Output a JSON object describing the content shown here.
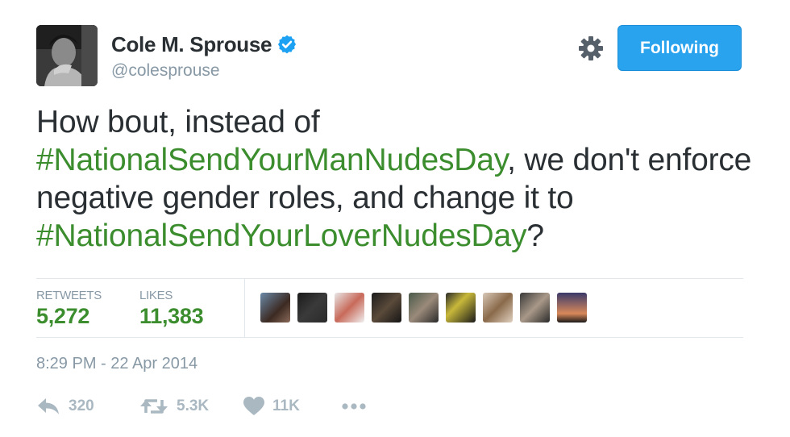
{
  "user": {
    "display_name": "Cole M. Sprouse",
    "handle": "@colesprouse",
    "verified": true
  },
  "follow_button": {
    "label": "Following"
  },
  "tweet": {
    "text_part_1": "How bout, instead of ",
    "hashtag_1": "#NationalSendYourManNudesDay",
    "text_part_2": ", we don't enforce negative gender roles, and change it to ",
    "hashtag_2": "#NationalSendYourLoverNudesDay",
    "text_part_3": "?"
  },
  "stats": {
    "retweets_label": "RETWEETS",
    "retweets_value": "5,272",
    "likes_label": "LIKES",
    "likes_value": "11,383"
  },
  "timestamp": "8:29 PM - 22 Apr 2014",
  "actions": {
    "reply_count": "320",
    "retweet_count": "5.3K",
    "like_count": "11K"
  },
  "colors": {
    "accent": "#3b8d2e",
    "button": "#2aa3ef",
    "muted": "#8899a6",
    "verified": "#1da1f2"
  },
  "icons": [
    "gear-icon",
    "verified-badge-icon",
    "reply-icon",
    "retweet-icon",
    "heart-icon",
    "more-icon"
  ]
}
